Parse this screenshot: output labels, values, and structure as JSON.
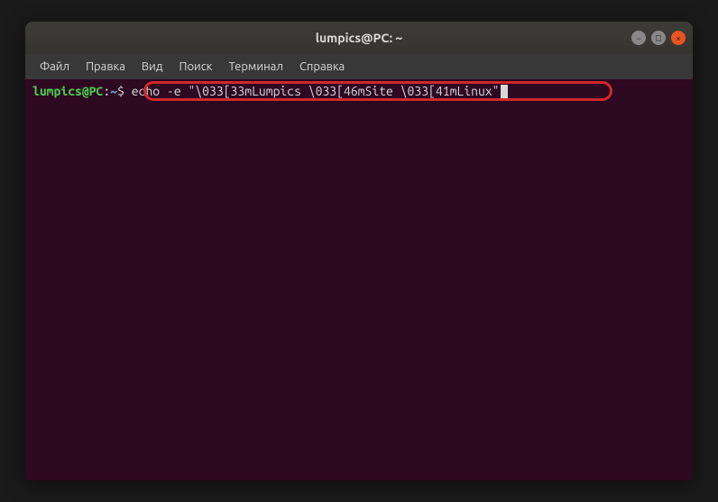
{
  "window": {
    "title": "lumpics@PC: ~"
  },
  "menu": {
    "file": "Файл",
    "edit": "Правка",
    "view": "Вид",
    "search": "Поиск",
    "terminal": "Терминал",
    "help": "Справка"
  },
  "prompt": {
    "user_host": "lumpics@PC",
    "colon": ":",
    "path": "~",
    "dollar": "$"
  },
  "command": "echo -e \"\\033[33mLumpics \\033[46mSite \\033[41mLinux\"",
  "controls": {
    "min": "−",
    "max": "□",
    "close": "×"
  }
}
